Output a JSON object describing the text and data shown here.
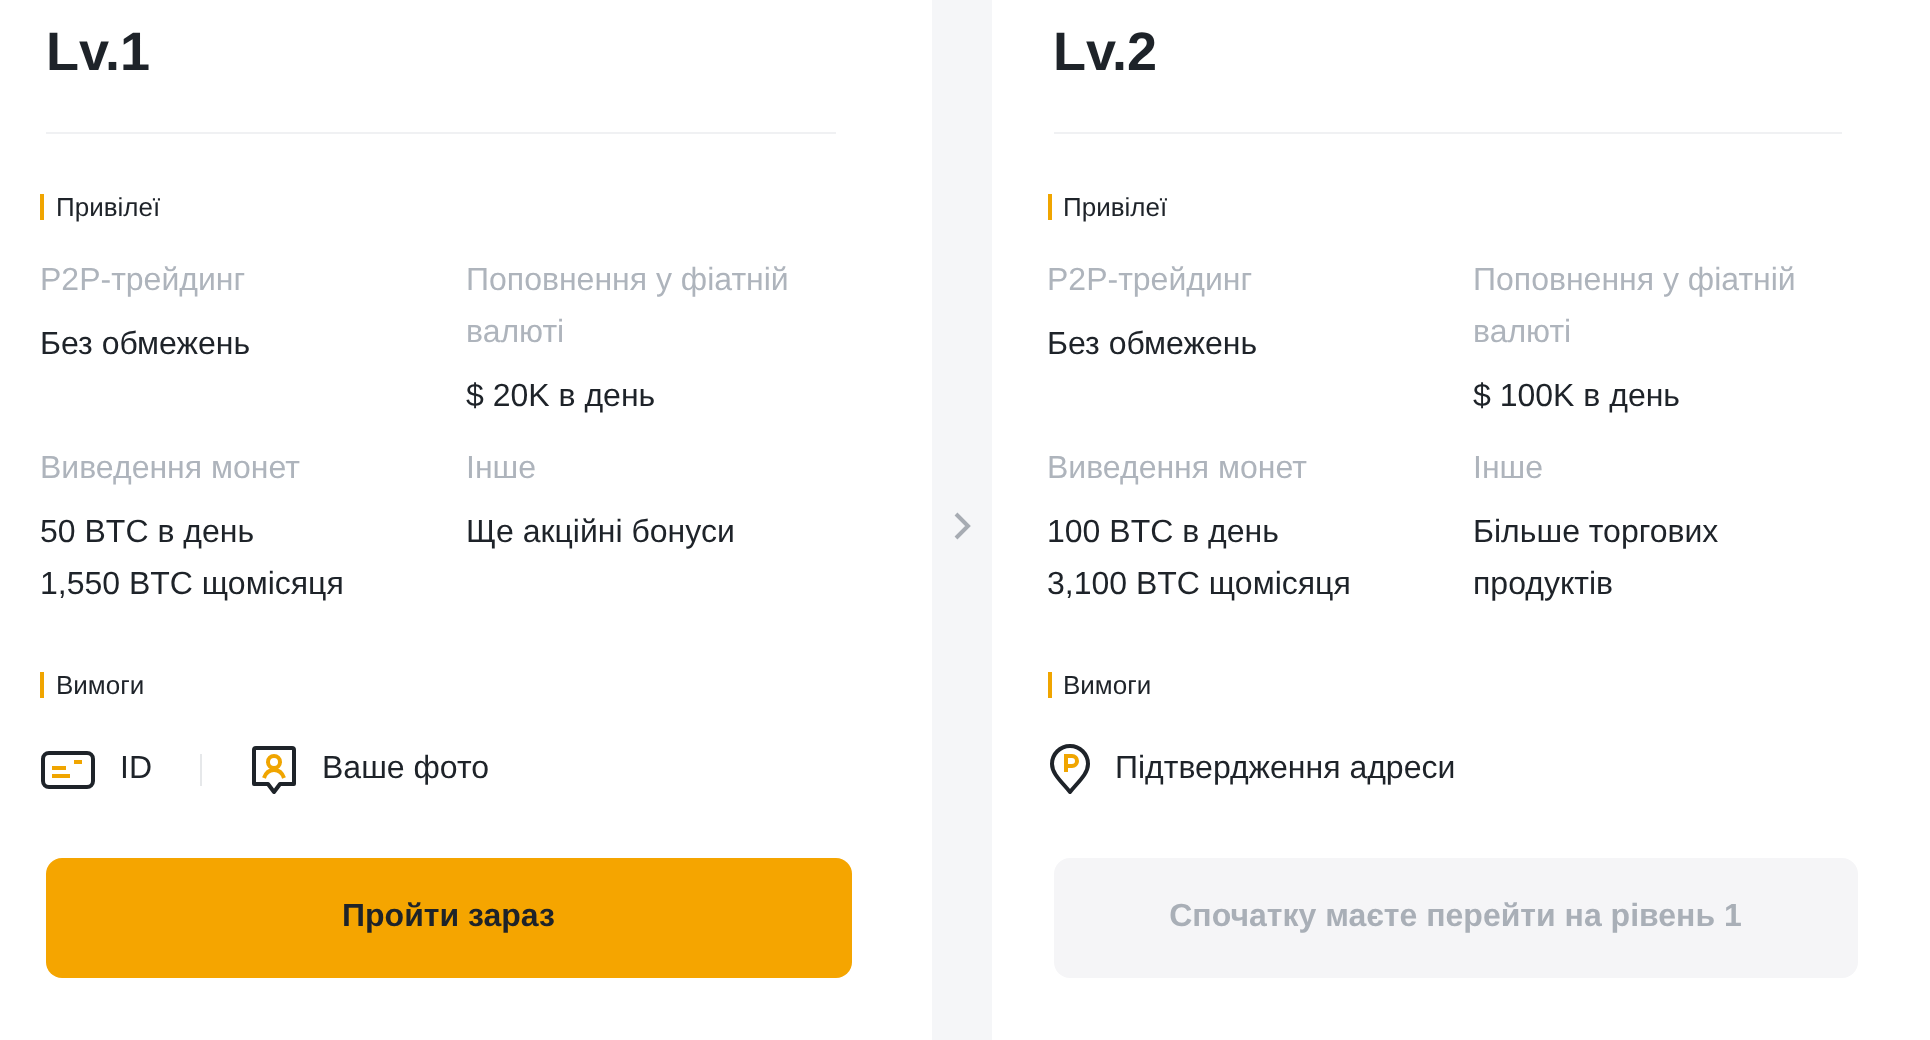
{
  "levels": [
    {
      "title": "Lv.1",
      "privileges_heading": "Привілеї",
      "privileges": [
        {
          "label": "P2P-трейдинг",
          "lines": [
            "Без обмежень"
          ]
        },
        {
          "label": "Поповнення у фіатній валюті",
          "lines": [
            "$ 20K в день"
          ]
        },
        {
          "label": "Виведення монет",
          "lines": [
            "50 BTC в день",
            "1,550 BTC щомісяця"
          ]
        },
        {
          "label": "Інше",
          "lines": [
            "Ще акційні бонуси"
          ]
        }
      ],
      "requirements_heading": "Вимоги",
      "requirements": [
        {
          "kind": "id",
          "label": "ID"
        },
        {
          "kind": "photo",
          "label": "Ваше фото"
        }
      ],
      "button": {
        "label": "Пройти зараз",
        "disabled": false
      }
    },
    {
      "title": "Lv.2",
      "privileges_heading": "Привілеї",
      "privileges": [
        {
          "label": "P2P-трейдинг",
          "lines": [
            "Без обмежень"
          ]
        },
        {
          "label": "Поповнення у фіатній валюті",
          "lines": [
            "$ 100K в день"
          ]
        },
        {
          "label": "Виведення монет",
          "lines": [
            "100 BTC в день",
            "3,100 BTC щомісяця"
          ]
        },
        {
          "label": "Інше",
          "lines": [
            "Більше торгових продуктів"
          ]
        }
      ],
      "requirements_heading": "Вимоги",
      "requirements": [
        {
          "kind": "address",
          "label": "Підтвердження адреси"
        }
      ],
      "button": {
        "label": "Спочатку маєте перейти на рівень 1",
        "disabled": true
      }
    }
  ]
}
